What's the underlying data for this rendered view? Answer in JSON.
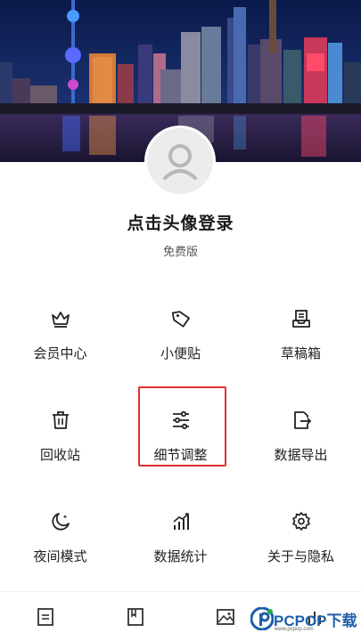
{
  "profile": {
    "title": "点击头像登录",
    "edition": "免费版"
  },
  "menu": [
    {
      "label": "会员中心",
      "icon": "crown-icon"
    },
    {
      "label": "小便贴",
      "icon": "tag-icon"
    },
    {
      "label": "草稿箱",
      "icon": "draft-box-icon"
    },
    {
      "label": "回收站",
      "icon": "trash-icon"
    },
    {
      "label": "细节调整",
      "icon": "sliders-icon"
    },
    {
      "label": "数据导出",
      "icon": "export-icon"
    },
    {
      "label": "夜间模式",
      "icon": "moon-icon"
    },
    {
      "label": "数据统计",
      "icon": "stats-icon"
    },
    {
      "label": "关于与隐私",
      "icon": "gear-icon"
    }
  ],
  "bottom_nav": [
    "document-icon",
    "notebook-icon",
    "image-icon",
    "chart-icon"
  ],
  "watermark": {
    "brand": "PCPOP下载",
    "sub": "www.pcpop.com"
  },
  "colors": {
    "highlight": "#e0302c",
    "watermark": "#1e5faa"
  }
}
